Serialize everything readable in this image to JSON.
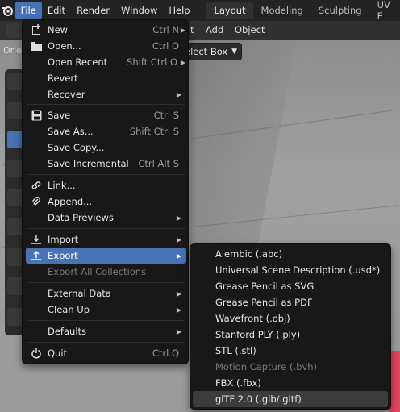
{
  "topbar": {
    "menus": [
      "File",
      "Edit",
      "Render",
      "Window",
      "Help"
    ],
    "workspaces": [
      "Layout",
      "Modeling",
      "Sculpting",
      "UV E"
    ]
  },
  "header": {
    "fragment_t": "t",
    "add_label": "Add",
    "object_label": "Object",
    "orientation_label": "Orie",
    "select_box_label": "elect Box"
  },
  "file_menu": {
    "new": {
      "label": "New",
      "shortcut": "Ctrl N"
    },
    "open": {
      "label": "Open...",
      "shortcut": "Ctrl O"
    },
    "open_recent": {
      "label": "Open Recent",
      "shortcut": "Shift Ctrl O"
    },
    "revert": {
      "label": "Revert"
    },
    "recover": {
      "label": "Recover"
    },
    "save": {
      "label": "Save",
      "shortcut": "Ctrl S"
    },
    "save_as": {
      "label": "Save As...",
      "shortcut": "Shift Ctrl S"
    },
    "save_copy": {
      "label": "Save Copy..."
    },
    "save_incremental": {
      "label": "Save Incremental",
      "shortcut": "Ctrl Alt S"
    },
    "link": {
      "label": "Link..."
    },
    "append": {
      "label": "Append..."
    },
    "data_previews": {
      "label": "Data Previews"
    },
    "import": {
      "label": "Import"
    },
    "export": {
      "label": "Export"
    },
    "export_all": {
      "label": "Export All Collections"
    },
    "external_data": {
      "label": "External Data"
    },
    "clean_up": {
      "label": "Clean Up"
    },
    "defaults": {
      "label": "Defaults"
    },
    "quit": {
      "label": "Quit",
      "shortcut": "Ctrl Q"
    }
  },
  "export_menu": [
    {
      "label": "Alembic (.abc)",
      "enabled": true
    },
    {
      "label": "Universal Scene Description (.usd*)",
      "enabled": true
    },
    {
      "label": "Grease Pencil as SVG",
      "enabled": true
    },
    {
      "label": "Grease Pencil as PDF",
      "enabled": true
    },
    {
      "label": "Wavefront (.obj)",
      "enabled": true
    },
    {
      "label": "Stanford PLY (.ply)",
      "enabled": true
    },
    {
      "label": "STL (.stl)",
      "enabled": true
    },
    {
      "label": "Motion Capture (.bvh)",
      "enabled": false
    },
    {
      "label": "FBX (.fbx)",
      "enabled": true
    },
    {
      "label": "glTF 2.0 (.glb/.gltf)",
      "enabled": true
    }
  ],
  "colors": {
    "accent": "#4772b3",
    "menu_bg": "#181818",
    "disabled": "#7a7a7a"
  }
}
